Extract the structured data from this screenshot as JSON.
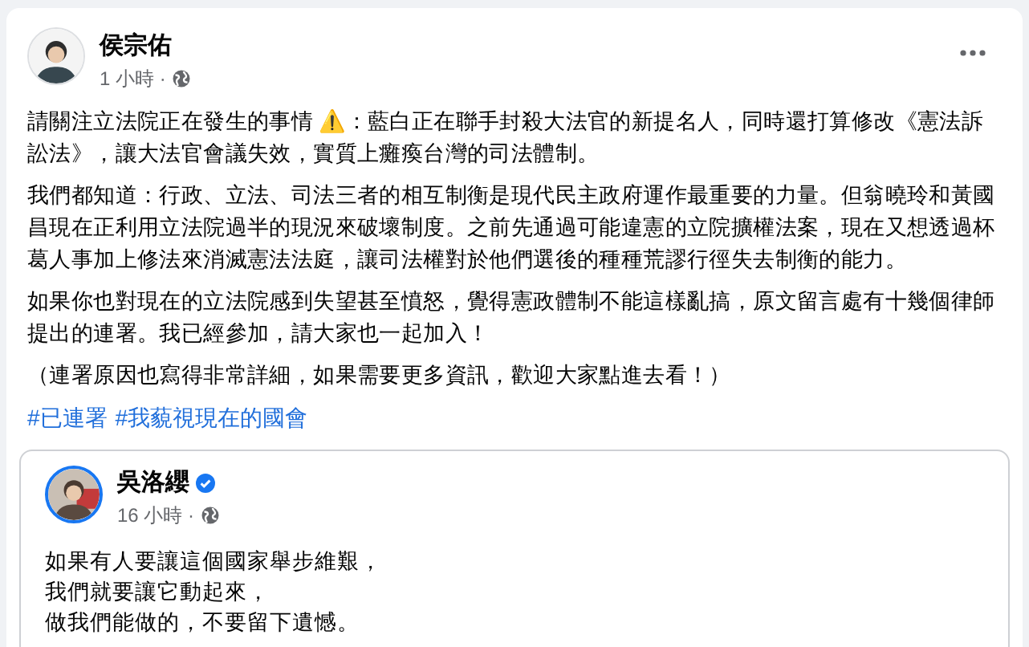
{
  "post": {
    "author": "侯宗佑",
    "time": "1 小時 ·",
    "paragraphs": [
      "請關注立法院正在發生的事情 ⚠️：藍白正在聯手封殺大法官的新提名人，同時還打算修改《憲法訴訟法》，讓大法官會議失效，實質上癱瘓台灣的司法體制。",
      "我們都知道：行政、立法、司法三者的相互制衡是現代民主政府運作最重要的力量。但翁曉玲和黃國昌現在正利用立法院過半的現況來破壞制度。之前先通過可能違憲的立院擴權法案，現在又想透過杯葛人事加上修法來消滅憲法法庭，讓司法權對於他們選後的種種荒謬行徑失去制衡的能力。",
      "如果你也對現在的立法院感到失望甚至憤怒，覺得憲政體制不能這樣亂搞，原文留言處有十幾個律師提出的連署。我已經參加，請大家也一起加入！",
      "（連署原因也寫得非常詳細，如果需要更多資訊，歡迎大家點進去看！）"
    ],
    "hashtags": [
      "#已連署",
      "#我藐視現在的國會"
    ],
    "shared": {
      "author": "吳洛纓",
      "verified": true,
      "time": "16 小時 ·",
      "lines": [
        "如果有人要讓這個國家舉步維艱，",
        "我們就要讓它動起來，",
        "做我們能做的，不要留下遺憾。"
      ]
    }
  }
}
